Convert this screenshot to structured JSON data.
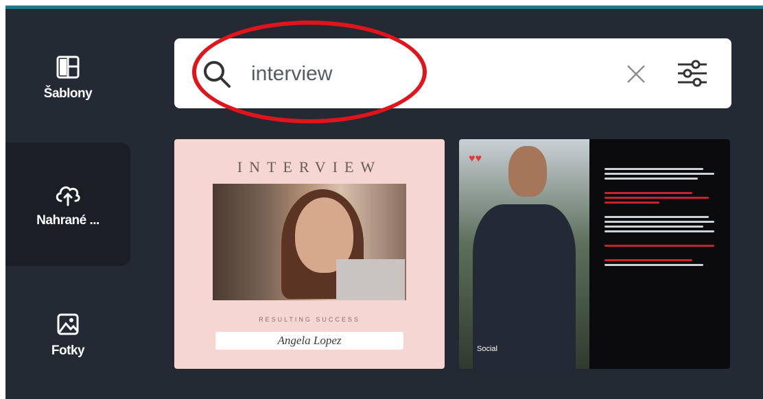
{
  "sidebar": {
    "items": [
      {
        "label": "Šablony",
        "icon": "templates-icon",
        "active": false
      },
      {
        "label": "Nahrané ...",
        "icon": "cloud-upload-icon",
        "active": true
      },
      {
        "label": "Fotky",
        "icon": "photos-icon",
        "active": false
      }
    ]
  },
  "search": {
    "value": "interview",
    "icon": "search-icon",
    "clear_icon": "close-icon",
    "filter_icon": "filter-sliders-icon"
  },
  "results": [
    {
      "title": "INTERVIEW",
      "subtitle": "RESULTING SUCCESS",
      "name": "Angela Lopez"
    },
    {
      "tag": "Social"
    }
  ],
  "colors": {
    "background": "#242a33",
    "accent_bar": "#1d7c89",
    "highlight": "#e1141b",
    "card1_bg": "#f5d6d2",
    "card2_bg": "#0b0b0d"
  }
}
